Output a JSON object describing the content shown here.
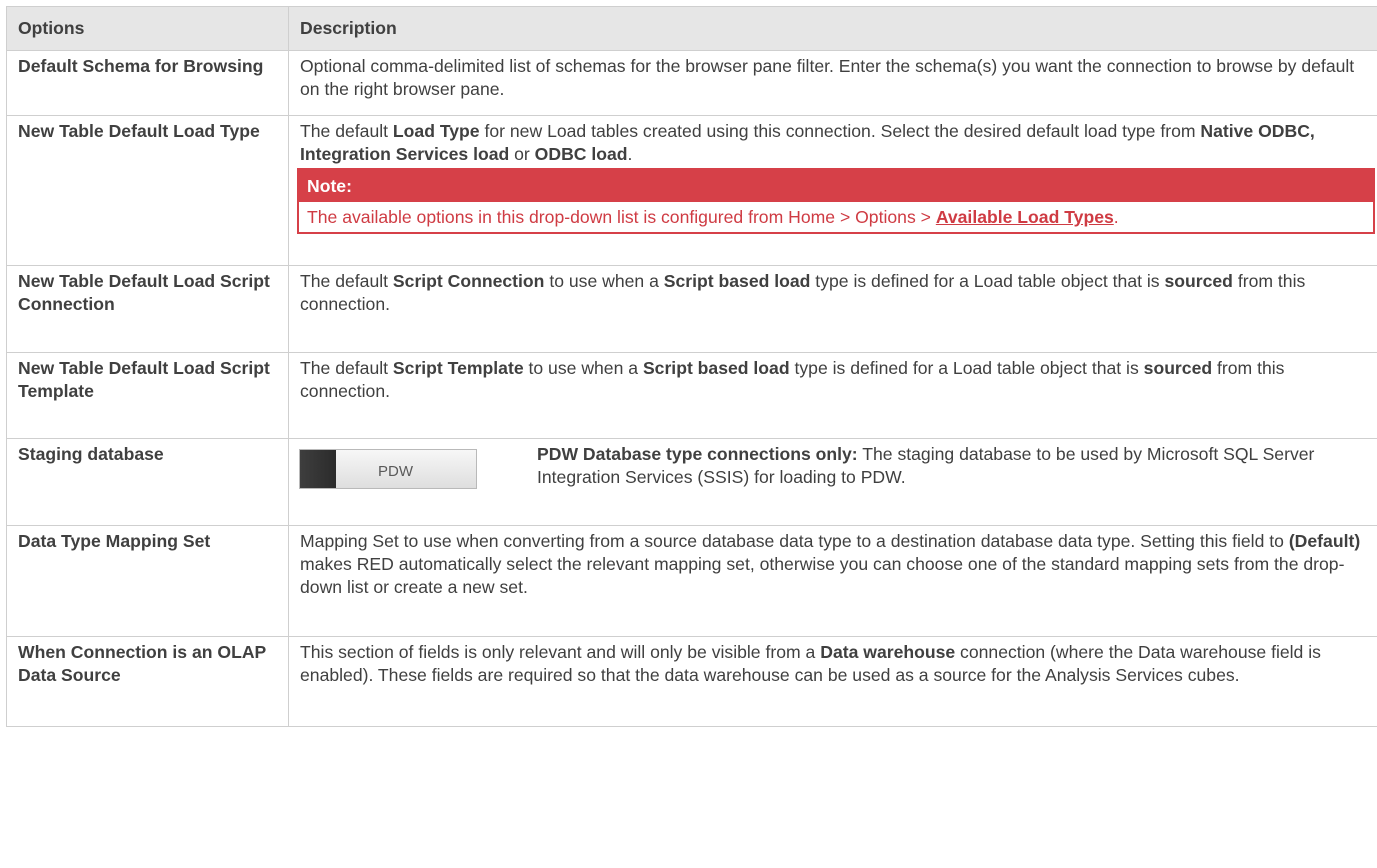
{
  "header": {
    "col_options": "Options",
    "col_description": "Description"
  },
  "rows": {
    "r0": {
      "option": "Default Schema for Browsing",
      "desc": "Optional comma-delimited list of schemas for the browser pane filter. Enter the schema(s) you want the connection to browse by default on the right browser pane."
    },
    "r1": {
      "option": "New Table Default Load Type",
      "p1": " The default ",
      "b1": "Load Type",
      "p2": " for new Load tables created using this connection. Select the desired default load type from ",
      "b2": "Native ODBC, Integration Services load",
      "p3": " or ",
      "b3": "ODBC load",
      "p4": ".",
      "note_title": "Note:",
      "note_text": " The available options in this drop-down list is configured from Home > Options > ",
      "note_link": "Available Load Types",
      "note_end": "."
    },
    "r2": {
      "option": "New Table Default Load Script Connection",
      "p1": "The default ",
      "b1": "Script Connection",
      "p2": " to use when a ",
      "b2": "Script based load",
      "p3": " type is defined for a Load table object that is ",
      "b3": "sourced",
      "p4": " from this connection."
    },
    "r3": {
      "option": "New Table Default Load Script Template",
      "p1": "The default ",
      "b1": "Script Template",
      "p2": " to use when a ",
      "b2": "Script based load",
      "p3": " type is defined for a Load table object that is ",
      "b3": "sourced",
      "p4": " from this connection."
    },
    "r4": {
      "option": "Staging database",
      "toggle_label": "PDW",
      "b1": "PDW Database type connections only:",
      "p1": " The staging database to be used by Microsoft SQL Server Integration Services (SSIS) for loading to PDW."
    },
    "r5": {
      "option": "Data Type Mapping Set",
      "p1": " Mapping Set to use when converting from a source database data type to a destination database data type. Setting this field to ",
      "b1": "(Default)",
      "p2": " makes RED automatically select the relevant mapping set, otherwise you can choose one of the standard mapping sets from the drop-down list or create a new set."
    },
    "r6": {
      "option": "When Connection is an OLAP Data Source",
      "p1": " This section of fields is only relevant and will only be visible from a ",
      "b1": "Data warehouse",
      "p2": " connection (where the Data warehouse field is enabled). These fields are required so that the data warehouse can be used as a source for the Analysis Services cubes."
    }
  }
}
